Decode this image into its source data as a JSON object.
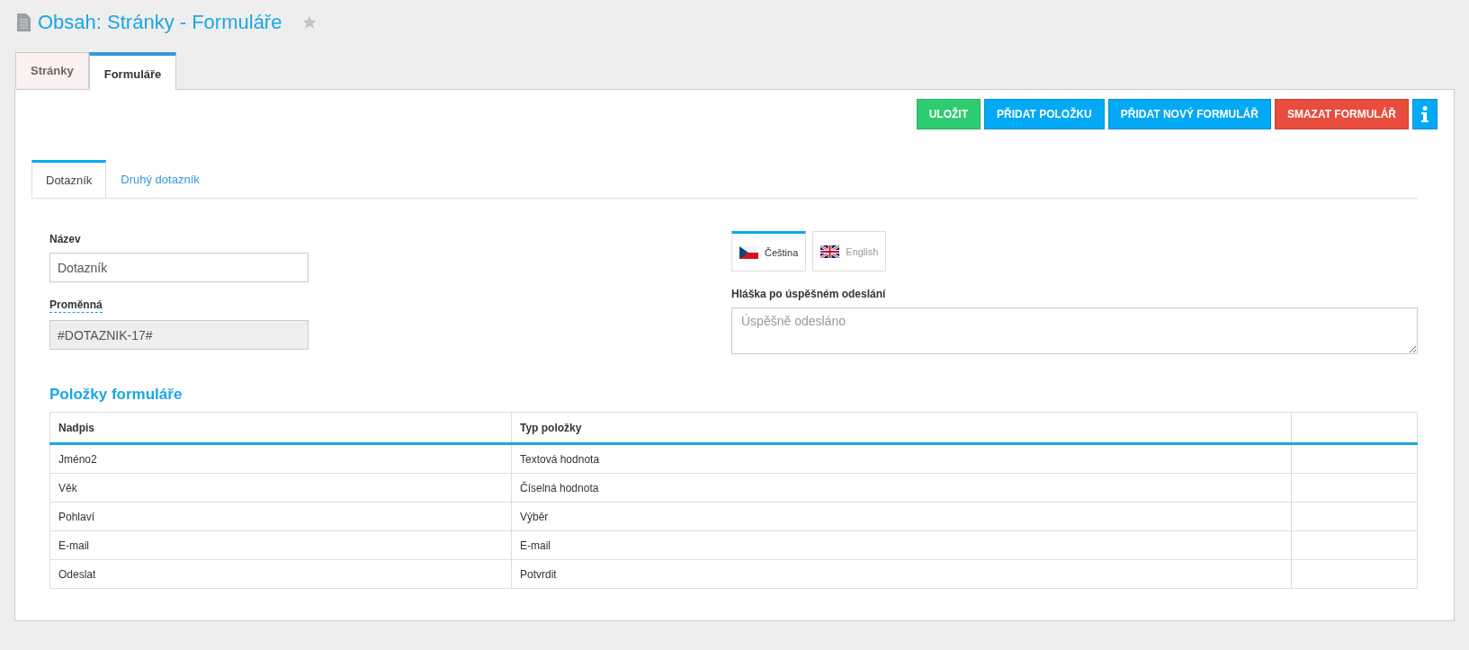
{
  "page_title": "Obsah: Stránky - Formuláře",
  "favorite": false,
  "tabs": [
    {
      "label": "Stránky",
      "selected": false
    },
    {
      "label": "Formuláře",
      "selected": true
    }
  ],
  "toolbar": [
    {
      "label": "ULOŽIT",
      "kind": "success"
    },
    {
      "label": "PŘIDAT POLOŽKU",
      "kind": "primary"
    },
    {
      "label": "PŘIDAT NOVÝ FORMULÁŘ",
      "kind": "primary"
    },
    {
      "label": "SMAZAT FORMULÁŘ",
      "kind": "danger"
    },
    {
      "kind": "info"
    }
  ],
  "form_tabs": [
    {
      "label": "Dotazník",
      "selected": true
    },
    {
      "label": "Druhý dotazník",
      "selected": false
    }
  ],
  "name_field": {
    "label": "Název",
    "value": "Dotazník"
  },
  "variable_field": {
    "label": "Proměnná",
    "value": "#DOTAZNIK-17#",
    "disabled": true
  },
  "languages": [
    {
      "label": "Čeština",
      "kind": "czech",
      "selected": true
    },
    {
      "label": "English",
      "kind": "british",
      "selected": false
    }
  ],
  "message_field": {
    "label": "Hláška po úspěšném odeslání",
    "placeholder": "Úspěšně odesláno"
  },
  "items_section": {
    "title": "Položky formuláře",
    "columns": [
      "Nadpis",
      "Typ položky"
    ],
    "rows": [
      [
        "Jméno2",
        "Textová hodnota"
      ],
      [
        "Věk",
        "Číselná hodnota"
      ],
      [
        "Pohlaví",
        "Výběr"
      ],
      [
        "E-mail",
        "E-mail"
      ],
      [
        "Odeslat",
        "Potvrdit"
      ]
    ]
  }
}
